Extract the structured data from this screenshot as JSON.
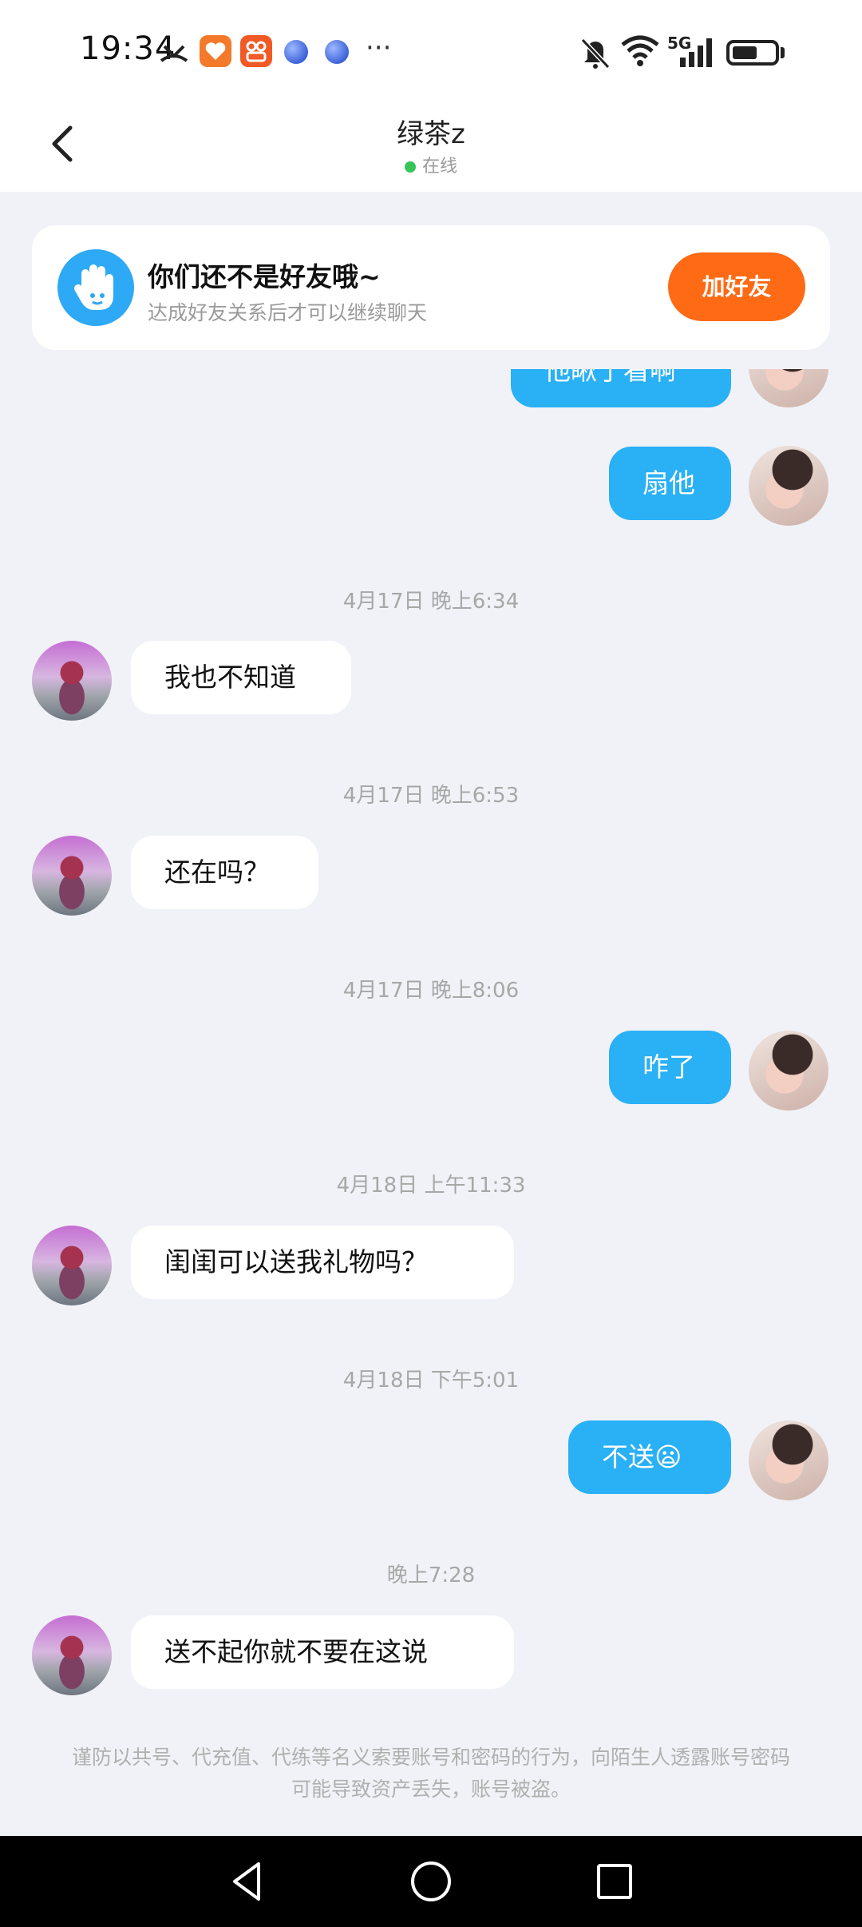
{
  "status_bar": {
    "time": "19:34",
    "network": "5G",
    "icons": [
      "missed-call-icon",
      "app-icon-orange",
      "app-icon-orange-2",
      "bubble-app-icon",
      "bubble-app-icon-2",
      "more-icon",
      "mute-icon",
      "wifi-icon",
      "signal-icon",
      "battery-icon"
    ],
    "more": "···"
  },
  "header": {
    "title": "绿茶z",
    "status": "在线"
  },
  "friend_card": {
    "title": "你们还不是好友哦~",
    "subtitle": "达成好友关系后才可以继续聊天",
    "button": "加好友",
    "button_color": "#ff6a14"
  },
  "messages": [
    {
      "type": "partial_out",
      "text": "他瞅了看啊"
    },
    {
      "type": "out",
      "text": "扇他"
    },
    {
      "type": "time",
      "text": "4月17日 晚上6:34"
    },
    {
      "type": "in",
      "text": "我也不知道"
    },
    {
      "type": "time",
      "text": "4月17日 晚上6:53"
    },
    {
      "type": "in",
      "text": "还在吗？"
    },
    {
      "type": "time",
      "text": "4月17日 晚上8:06"
    },
    {
      "type": "out",
      "text": "咋了"
    },
    {
      "type": "time",
      "text": "4月18日 上午11:33"
    },
    {
      "type": "in",
      "text": "闺闺可以送我礼物吗？"
    },
    {
      "type": "time",
      "text": "4月18日 下午5:01"
    },
    {
      "type": "out",
      "text": "不送😦"
    },
    {
      "type": "time",
      "text": "晚上7:28"
    },
    {
      "type": "in",
      "text": "送不起你就不要在这说"
    }
  ],
  "notice": "谨防以共号、代充值、代练等名义索要账号和密码的行为，向陌生人透露账号密码可能导致资产丢失，账号被盗。",
  "colors": {
    "outgoing_bubble": "#2ab0f5",
    "incoming_bubble": "#ffffff",
    "background": "#f1f2f7",
    "online_dot": "#35c558"
  }
}
